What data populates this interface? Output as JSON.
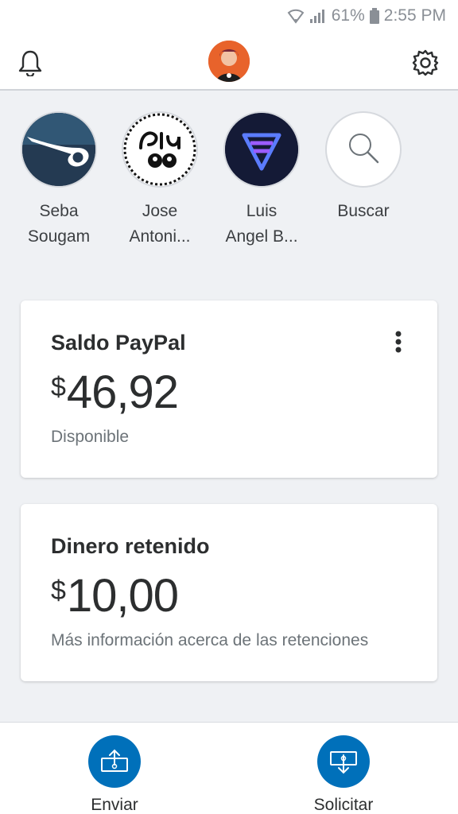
{
  "status_bar": {
    "battery_percent": "61%",
    "time": "2:55 PM",
    "icons": [
      "wifi-icon",
      "signal-icon",
      "battery-icon"
    ]
  },
  "header": {
    "icons": [
      "bell-icon",
      "avatar",
      "gear-icon"
    ]
  },
  "contacts": [
    {
      "line1": "Seba",
      "line2": "Sougam"
    },
    {
      "line1": "Jose",
      "line2": "Antoni..."
    },
    {
      "line1": "Luis",
      "line2": "Angel B..."
    },
    {
      "line1": "Buscar",
      "line2": ""
    }
  ],
  "balance_card": {
    "title": "Saldo PayPal",
    "currency": "$",
    "amount": "46,92",
    "subtitle": "Disponible"
  },
  "held_card": {
    "title": "Dinero retenido",
    "currency": "$",
    "amount": "10,00",
    "subtitle": "Más información acerca de las retenciones"
  },
  "bottom_actions": {
    "send_label": "Enviar",
    "request_label": "Solicitar"
  },
  "colors": {
    "accent": "#0070ba",
    "background": "#eff1f4"
  }
}
